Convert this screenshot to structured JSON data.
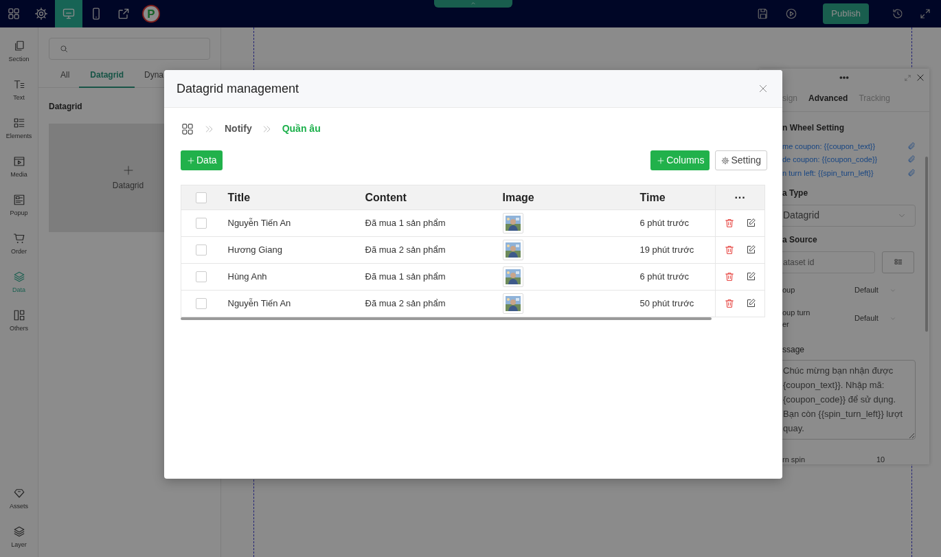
{
  "topbar": {
    "tools": [
      {
        "kind": "apps",
        "selected": false
      },
      {
        "kind": "settings",
        "selected": false
      },
      {
        "kind": "desktop",
        "selected": true
      },
      {
        "kind": "mobile",
        "selected": false
      },
      {
        "kind": "share",
        "selected": false
      }
    ],
    "logo_letter": "P",
    "actions": [
      {
        "kind": "save"
      },
      {
        "kind": "preview"
      },
      {
        "kind": "publish",
        "label": "Publish"
      },
      {
        "kind": "history"
      },
      {
        "kind": "fullscreen"
      }
    ]
  },
  "sidebar": {
    "items": [
      {
        "kind": "section",
        "label": "Section",
        "selected": false
      },
      {
        "kind": "text",
        "label": "Text",
        "selected": false
      },
      {
        "kind": "elements",
        "label": "Elements",
        "selected": false
      },
      {
        "kind": "media",
        "label": "Media",
        "selected": false
      },
      {
        "kind": "popup",
        "label": "Popup",
        "selected": false
      },
      {
        "kind": "order",
        "label": "Order",
        "selected": false
      },
      {
        "kind": "data",
        "label": "Data",
        "selected": true
      },
      {
        "kind": "others",
        "label": "Others",
        "selected": false
      }
    ],
    "bottom_items": [
      {
        "kind": "assets",
        "label": "Assets",
        "selected": false
      },
      {
        "kind": "layer",
        "label": "Layer",
        "selected": false
      }
    ]
  },
  "panel": {
    "tabs": [
      {
        "label": "All",
        "selected": false
      },
      {
        "label": "Datagrid",
        "selected": true
      },
      {
        "label": "Dyna",
        "selected": false
      }
    ],
    "heading": "Datagrid",
    "tile_label": "Datagrid"
  },
  "settings": {
    "tabs": [
      {
        "label": "sign",
        "selected": false
      },
      {
        "label": "Advanced",
        "selected": true
      },
      {
        "label": "Tracking",
        "selected": false
      }
    ],
    "section_title": "n Wheel Setting",
    "variables": [
      "me coupon: {{coupon_text}}",
      "de coupon: {{coupon_code}}",
      "n turn left: {{spin_turn_left}}"
    ],
    "type_label": "a Type",
    "type_value": "Datagrid",
    "source_label": "a Source",
    "source_placeholder": "ataset id",
    "selects": [
      {
        "label": [
          "oup"
        ],
        "value": "Default"
      },
      {
        "label": [
          "oup turn",
          "er"
        ],
        "value": "Default"
      }
    ],
    "message_label": "ssage",
    "message_lines": [
      "Chúc mừng bạn nhận được",
      "{coupon_text}}. Nhập mã:",
      "{coupon_code}} để sử dụng.",
      "Bạn còn {{spin_turn_left}} lượt",
      "quay."
    ],
    "spin_label": "rn spin",
    "spin_value": "10"
  },
  "modal": {
    "title": "Datagrid management",
    "breadcrumb": [
      {
        "label": "Notify",
        "selected": false
      },
      {
        "label": "Quần âu",
        "selected": true
      }
    ],
    "add_data": "Data",
    "add_columns": "Columns",
    "setting": "Setting",
    "table": {
      "header_checked": false,
      "columns": [
        "Title",
        "Content",
        "Image",
        "Time"
      ],
      "actions_header": "···",
      "rows": [
        {
          "checked": false,
          "title": "Nguyễn Tiến An",
          "content": "Đã mua 1 sản phẩm",
          "time": "6 phút trước"
        },
        {
          "checked": false,
          "title": "Hương Giang",
          "content": "Đã mua 2 sản phẩm",
          "time": "19 phút trước"
        },
        {
          "checked": false,
          "title": "Hùng Anh",
          "content": "Đã mua 1 sản phẩm",
          "time": "6 phút trước"
        },
        {
          "checked": false,
          "title": "Nguyễn Tiến An",
          "content": "Đã mua 2 sản phẩm",
          "time": "50 phút trước"
        }
      ]
    }
  }
}
